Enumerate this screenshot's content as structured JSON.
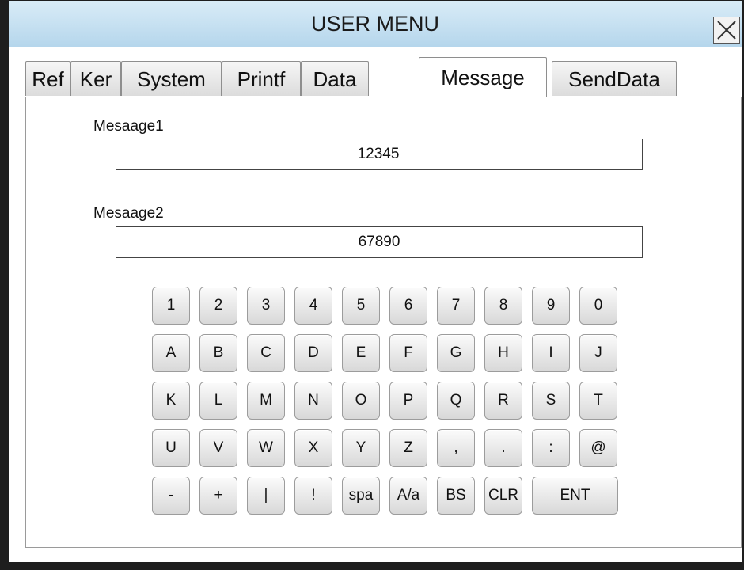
{
  "window": {
    "title": "USER MENU"
  },
  "tabs": [
    "Ref",
    "Ker",
    "System",
    "Printf",
    "Data",
    "Message",
    "SendData"
  ],
  "active_tab": "Message",
  "fields": [
    {
      "label": "Mesaage1",
      "value": "12345"
    },
    {
      "label": "Mesaage2",
      "value": "67890"
    }
  ],
  "keyboard": {
    "rows": [
      [
        "1",
        "2",
        "3",
        "4",
        "5",
        "6",
        "7",
        "8",
        "9",
        "0"
      ],
      [
        "A",
        "B",
        "C",
        "D",
        "E",
        "F",
        "G",
        "H",
        "I",
        "J"
      ],
      [
        "K",
        "L",
        "M",
        "N",
        "O",
        "P",
        "Q",
        "R",
        "S",
        "T"
      ],
      [
        "U",
        "V",
        "W",
        "X",
        "Y",
        "Z",
        ",",
        ".",
        ":",
        "@"
      ],
      [
        "-",
        "+",
        "|",
        "!",
        "spa",
        "A/a",
        "BS",
        "CLR",
        "ENT"
      ]
    ]
  },
  "icons": {
    "close": "close-icon",
    "scroll": "right-arrow-icon"
  }
}
